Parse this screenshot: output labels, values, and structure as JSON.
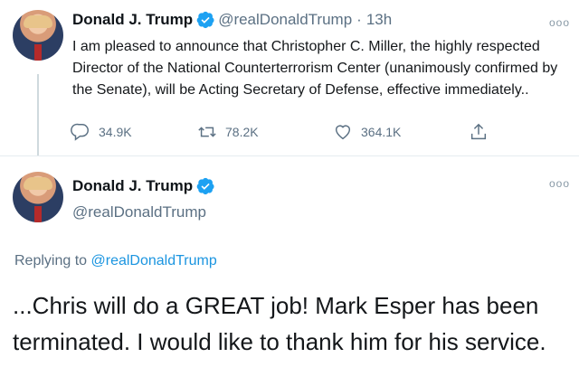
{
  "tweet1": {
    "name": "Donald J. Trump",
    "handle": "@realDonaldTrump",
    "separator": "·",
    "time": "13h",
    "more": "ooo",
    "text": "I am pleased to announce that Christopher C. Miller, the highly respected Director of the National Counterterrorism Center (unanimously confirmed by the Senate), will be Acting Secretary of Defense, effective immediately..",
    "replies": "34.9K",
    "retweets": "78.2K",
    "likes": "364.1K"
  },
  "tweet2": {
    "name": "Donald J. Trump",
    "handle": "@realDonaldTrump",
    "more": "ooo",
    "replying_prefix": "Replying to ",
    "replying_handle": "@realDonaldTrump",
    "text": "...Chris will do a GREAT job! Mark Esper has been terminated. I would like to thank him for his service."
  },
  "colors": {
    "verified": "#1da1f2",
    "link": "#1b95e0",
    "secondary": "#5b7083"
  }
}
